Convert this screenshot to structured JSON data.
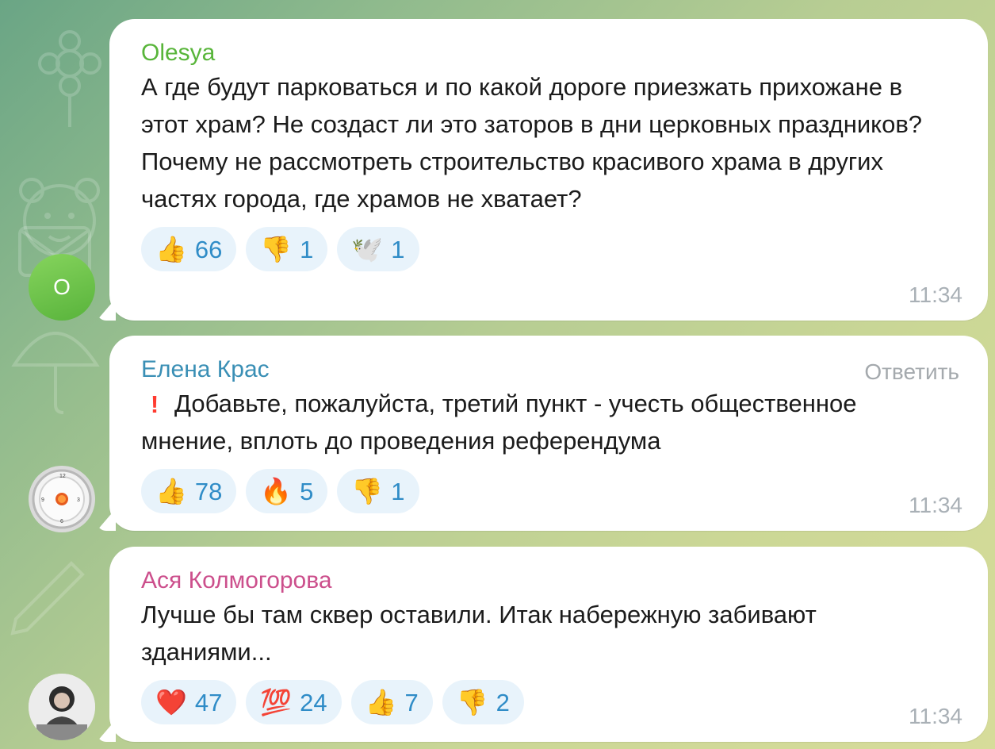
{
  "messages": [
    {
      "author": "Olesya",
      "avatar_text": "O",
      "avatar_type": "letter",
      "text": "А где будут парковаться и по какой дороге приезжать прихожане в этот храм? Не создаст ли это заторов в дни церковных праздников? Почему не рассмотреть строительство красивого храма в других частях города, где храмов не хватает?",
      "reactions": [
        {
          "icon": "👍",
          "count": "66"
        },
        {
          "icon": "👎",
          "count": "1"
        },
        {
          "icon": "🕊️",
          "count": "1"
        }
      ],
      "time": "11:34"
    },
    {
      "author": "Елена Крас",
      "avatar_type": "clock",
      "reply_label": "Ответить",
      "text": "Добавьте, пожалуйста, третий пункт - учесть общественное мнение, вплоть до проведения референдума",
      "emoji_prefix": "!",
      "reactions": [
        {
          "icon": "👍",
          "count": "78"
        },
        {
          "icon": "🔥",
          "count": "5"
        },
        {
          "icon": "👎",
          "count": "1"
        }
      ],
      "time": "11:34"
    },
    {
      "author": "Ася Колмогорова",
      "avatar_type": "photo",
      "text": "Лучше бы там сквер оставили. Итак набережную забивают зданиями...",
      "reactions": [
        {
          "icon": "❤️",
          "count": "47"
        },
        {
          "icon": "💯",
          "count": "24"
        },
        {
          "icon": "👍",
          "count": "7"
        },
        {
          "icon": "👎",
          "count": "2"
        }
      ],
      "time": "11:34"
    }
  ]
}
